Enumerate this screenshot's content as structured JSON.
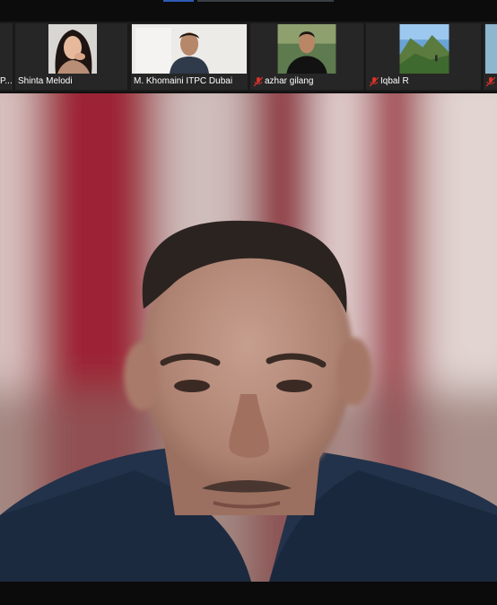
{
  "participants": [
    {
      "id": "p0",
      "name": "P...",
      "muted": false
    },
    {
      "id": "p1",
      "name": "Shinta Melodi",
      "muted": false
    },
    {
      "id": "p2",
      "name": "M. Khomaini ITPC Dubai",
      "muted": false
    },
    {
      "id": "p3",
      "name": "azhar gilang",
      "muted": true
    },
    {
      "id": "p4",
      "name": "Iqbal R",
      "muted": true
    },
    {
      "id": "p5",
      "name": "",
      "muted": true
    }
  ],
  "colors": {
    "mute_red": "#d9322b",
    "tile_bg": "#262626",
    "strip_bg": "#1a1a1a"
  }
}
